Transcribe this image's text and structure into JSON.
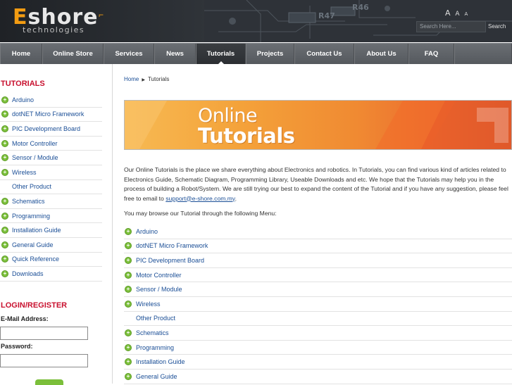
{
  "header": {
    "logo_first": "E",
    "logo_rest": "shore",
    "logo_sub": "technologies",
    "font_sizes": [
      "A",
      "A",
      "A"
    ],
    "search_placeholder": "Search Here...",
    "search_button": "Search"
  },
  "nav": {
    "items": [
      {
        "label": "Home"
      },
      {
        "label": "Online Store"
      },
      {
        "label": "Services"
      },
      {
        "label": "News"
      },
      {
        "label": "Tutorials",
        "active": true
      },
      {
        "label": "Projects"
      },
      {
        "label": "Contact Us"
      },
      {
        "label": "About Us"
      },
      {
        "label": "FAQ"
      }
    ]
  },
  "sidebar": {
    "heading": "TUTORIALS",
    "items": [
      {
        "label": "Arduino"
      },
      {
        "label": "dotNET Micro Framework"
      },
      {
        "label": "PIC Development Board"
      },
      {
        "label": "Motor Controller"
      },
      {
        "label": "Sensor / Module"
      },
      {
        "label": "Wireless"
      },
      {
        "label": "Other Product"
      },
      {
        "label": "Schematics"
      },
      {
        "label": "Programming"
      },
      {
        "label": "Installation Guide"
      },
      {
        "label": "General Guide"
      },
      {
        "label": "Quick Reference"
      },
      {
        "label": "Downloads"
      }
    ],
    "login_heading": "LOGIN/REGISTER",
    "email_label": "E-Mail Address:",
    "password_label": "Password:"
  },
  "main": {
    "breadcrumb_home": "Home",
    "breadcrumb_current": "Tutorials",
    "banner_line1": "Online",
    "banner_line2": "Tutorials",
    "intro_text": "Our Online Tutorials is the place we share everything about Electronics and robotics. In Tutorials, you can find various kind of articles related to Electronics Guide, Schematic Diagram, Programming Library, Useable Downloads and etc. We hope that the Tutorials may help you in the process of building a Robot/System. We are still trying our best to expand the content of the Tutorial and if you have any suggestion, please feel free to email to",
    "support_email": "support@e-shore.com.my",
    "intro_end": ".",
    "browse_text": "You may browse our Tutorial through the following Menu:",
    "items": [
      {
        "label": "Arduino"
      },
      {
        "label": "dotNET Micro Framework"
      },
      {
        "label": "PIC Development Board"
      },
      {
        "label": "Motor Controller"
      },
      {
        "label": "Sensor / Module"
      },
      {
        "label": "Wireless"
      },
      {
        "label": "Other Product"
      },
      {
        "label": "Schematics"
      },
      {
        "label": "Programming"
      },
      {
        "label": "Installation Guide"
      },
      {
        "label": "General Guide"
      }
    ]
  },
  "colors": {
    "accent_orange": "#f39c12",
    "heading_red": "#c8102e",
    "link_blue": "#1a4e96",
    "bullet_green": "#7bbf3a"
  }
}
